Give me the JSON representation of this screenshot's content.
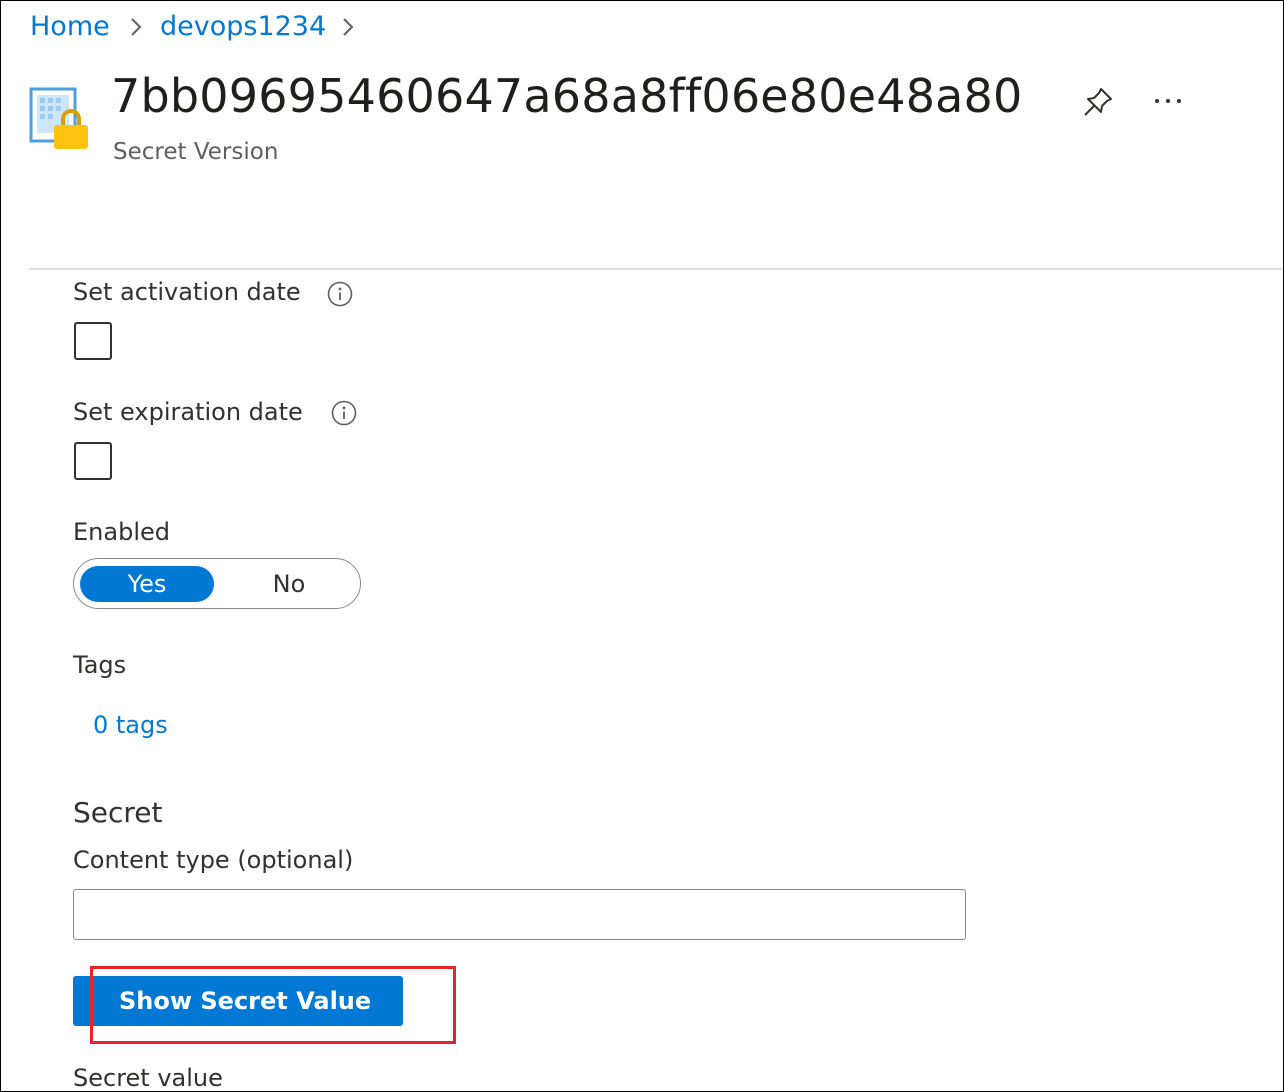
{
  "breadcrumb": {
    "items": [
      "Home",
      "devops1234"
    ]
  },
  "header": {
    "title": "7bb09695460647a68a8ff06e80e48a80",
    "subtitle": "Secret Version"
  },
  "form": {
    "activation_label": "Set activation date",
    "expiration_label": "Set expiration date",
    "enabled_label": "Enabled",
    "enabled_options": [
      "Yes",
      "No"
    ],
    "enabled_value": "Yes",
    "tags_label": "Tags",
    "tags_link": "0 tags",
    "secret_section": "Secret",
    "content_type_label": "Content type (optional)",
    "content_type_value": "",
    "show_secret_button": "Show Secret Value",
    "secret_value_label": "Secret value"
  },
  "colors": {
    "accent": "#0078d4",
    "highlight": "#e32726"
  },
  "icons": {
    "resource": "secret-lock-icon",
    "pin": "pin-icon",
    "more": "more-options-icon",
    "info": "info-icon",
    "chevron": "chevron-right-icon"
  }
}
